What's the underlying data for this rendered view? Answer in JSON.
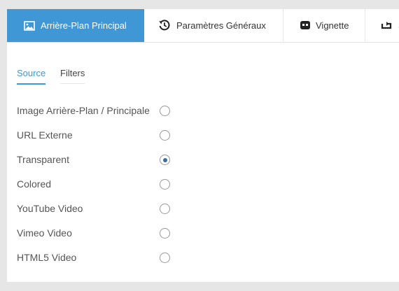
{
  "tabs": [
    {
      "label": "Arrière-Plan Principal",
      "icon": "image-icon",
      "active": true
    },
    {
      "label": "Paramètres Généraux",
      "icon": "history-icon",
      "active": false
    },
    {
      "label": "Vignette",
      "icon": "thumbnail-icon",
      "active": false
    },
    {
      "label": "S",
      "icon": "loop-icon",
      "active": false
    }
  ],
  "subtabs": [
    {
      "label": "Source",
      "active": true
    },
    {
      "label": "Filters",
      "active": false
    }
  ],
  "background_options": [
    {
      "label": "Image Arrière-Plan / Principale",
      "checked": false
    },
    {
      "label": "URL Externe",
      "checked": false
    },
    {
      "label": "Transparent",
      "checked": true
    },
    {
      "label": "Colored",
      "checked": false
    },
    {
      "label": "YouTube Video",
      "checked": false
    },
    {
      "label": "Vimeo Video",
      "checked": false
    },
    {
      "label": "HTML5 Video",
      "checked": false
    }
  ],
  "colors": {
    "accent": "#3f97d6",
    "radio_checked": "#2f6ea8",
    "page_background": "#e6e6e6"
  }
}
